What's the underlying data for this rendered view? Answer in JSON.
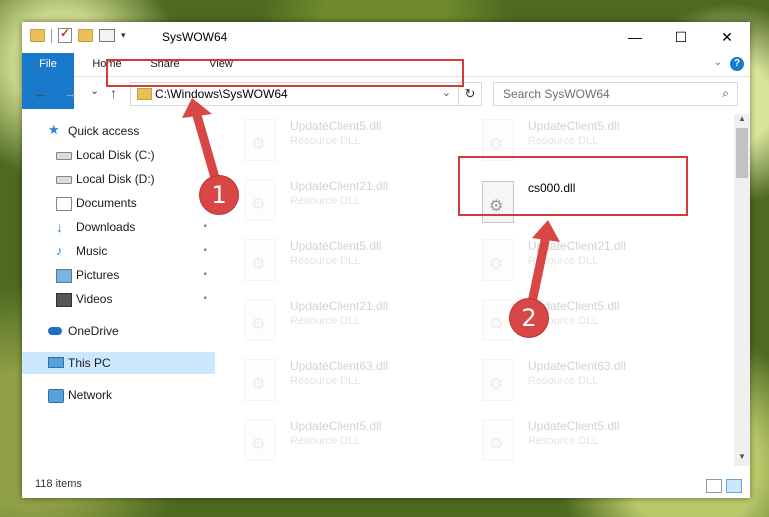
{
  "window": {
    "title": "SysWOW64",
    "controls": {
      "minimize": "—",
      "maximize": "☐",
      "close": "✕"
    }
  },
  "ribbon": {
    "tabs": [
      {
        "label": "File"
      },
      {
        "label": "Home"
      },
      {
        "label": "Share"
      },
      {
        "label": "View"
      }
    ],
    "help": "?"
  },
  "navigation": {
    "back": "←",
    "forward": "→",
    "recent": "⌄",
    "up": "↑",
    "address": "C:\\Windows\\SysWOW64",
    "address_dropdown": "⌄",
    "refresh": "↻",
    "search_placeholder": "Search SysWOW64",
    "search_icon": "⌕"
  },
  "sidebar": {
    "items": [
      {
        "label": "Quick access",
        "icon": "star-icon",
        "pinned": false
      },
      {
        "label": "Local Disk (C:)",
        "icon": "drive-icon",
        "pinned": false
      },
      {
        "label": "Local Disk (D:)",
        "icon": "drive-icon",
        "pinned": false
      },
      {
        "label": "Documents",
        "icon": "documents-icon",
        "pinned": false
      },
      {
        "label": "Downloads",
        "icon": "downloads-icon",
        "pinned": true
      },
      {
        "label": "Music",
        "icon": "music-icon",
        "pinned": true
      },
      {
        "label": "Pictures",
        "icon": "pictures-icon",
        "pinned": true
      },
      {
        "label": "Videos",
        "icon": "videos-icon",
        "pinned": true
      },
      {
        "label": "OneDrive",
        "icon": "onedrive-icon",
        "pinned": false
      },
      {
        "label": "This PC",
        "icon": "this-pc-icon",
        "pinned": false,
        "selected": true
      },
      {
        "label": "Network",
        "icon": "network-icon",
        "pinned": false
      }
    ],
    "pin_glyph": "📌"
  },
  "files": {
    "left_column": [
      {
        "name": "UpdateClient5.dll",
        "type": "Resource DLL"
      },
      {
        "name": "UpdateClient21.dll",
        "type": "Resource DLL"
      },
      {
        "name": "UpdateClient5.dll",
        "type": "Resource DLL"
      },
      {
        "name": "UpdateClient21.dll",
        "type": "Resource DLL"
      },
      {
        "name": "UpdateClient63.dll",
        "type": "Resource DLL"
      },
      {
        "name": "UpdateClient5.dll",
        "type": "Resource DLL"
      }
    ],
    "right_column": [
      {
        "name": "UpdateClient5.dll",
        "type": "Resource DLL"
      },
      {
        "name": "cs000.dll",
        "type": ""
      },
      {
        "name": "UpdateClient21.dll",
        "type": "Resource DLL"
      },
      {
        "name": "UpdateClient5.dll",
        "type": "Resource DLL"
      },
      {
        "name": "UpdateClient63.dll",
        "type": "Resource DLL"
      },
      {
        "name": "UpdateClient5.dll",
        "type": "Resource DLL"
      }
    ]
  },
  "annotations": {
    "marker_1": "1",
    "marker_2": "2",
    "highlight_color": "#d23a3a"
  },
  "status": {
    "item_count": "118 items"
  },
  "colors": {
    "accent": "#1979ca",
    "selection": "#cce8ff"
  }
}
